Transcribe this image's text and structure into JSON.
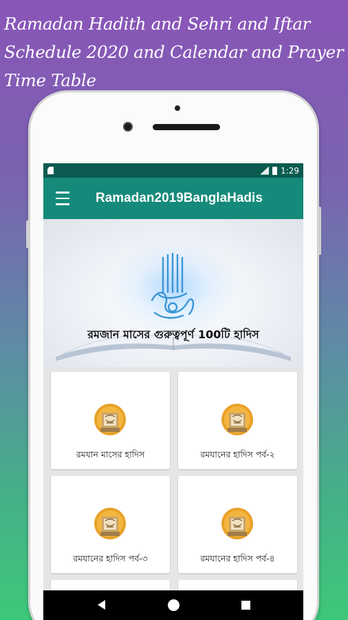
{
  "promo": {
    "line1": "Ramadan Hadith and Sehri and Iftar",
    "line2": "Schedule 2020 and Calendar and Prayer",
    "line3": "Time Table"
  },
  "status_bar": {
    "time": "1:29"
  },
  "app_bar": {
    "title": "Ramadan2019BanglaHadis"
  },
  "banner": {
    "text": "রমজান মাসের গুরুত্বপূর্ণ 100টি হাদিস"
  },
  "cards": [
    {
      "label": "রমযান মাসের হাদিস",
      "icon": "quran-icon"
    },
    {
      "label": "রমযানের হাদিস পর্ব-২",
      "icon": "quran-icon"
    },
    {
      "label": "রমযানের হাদিস পর্ব-৩",
      "icon": "quran-icon"
    },
    {
      "label": "রমযানের হাদিস পর্ব-৪",
      "icon": "quran-icon"
    }
  ],
  "colors": {
    "status_bar": "#0a5a50",
    "app_bar": "#158a7a",
    "icon_gold": "#e8a22a"
  }
}
